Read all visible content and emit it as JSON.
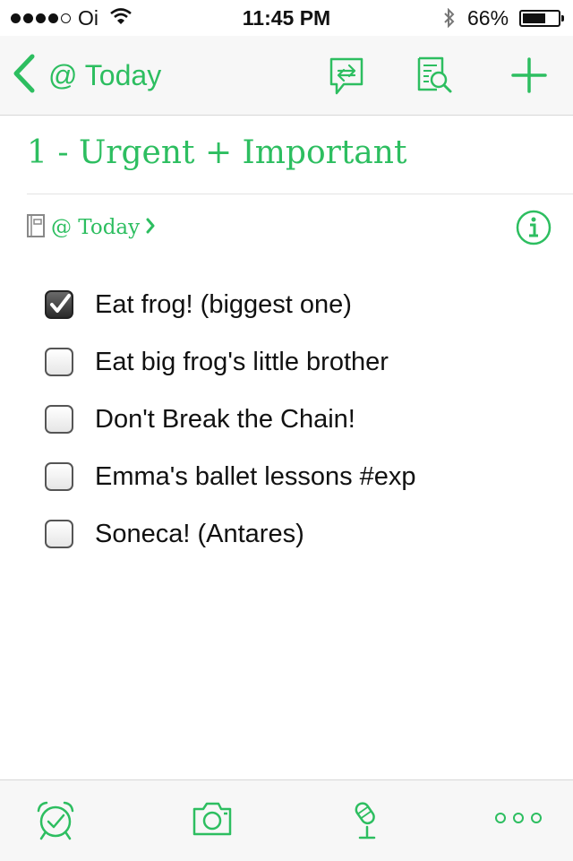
{
  "status_bar": {
    "carrier": "Oi",
    "time": "11:45 PM",
    "battery_percent": "66%",
    "battery_level": 0.66,
    "signal_bars_filled": 4,
    "signal_bars_total": 5
  },
  "nav": {
    "back_label": "@ Today",
    "icons": [
      "chevron-left-icon",
      "share-icon",
      "search-note-icon",
      "plus-icon"
    ]
  },
  "note": {
    "title": "1 - Urgent + Important",
    "notebook": "@ Today",
    "todos": [
      {
        "text": "Eat frog! (biggest one)",
        "checked": true
      },
      {
        "text": "Eat big frog's little brother",
        "checked": false
      },
      {
        "text": "Don't Break the Chain!",
        "checked": false
      },
      {
        "text": "Emma's ballet lessons #exp",
        "checked": false
      },
      {
        "text": "Soneca! (Antares)",
        "checked": false
      }
    ]
  },
  "toolbar": {
    "icons": [
      "alarm-clock-icon",
      "camera-icon",
      "microphone-icon",
      "more-icon"
    ]
  },
  "colors": {
    "accent": "#2dbe60",
    "bar_background": "#f7f7f7",
    "divider": "#d7d7d7",
    "text": "#111111"
  }
}
